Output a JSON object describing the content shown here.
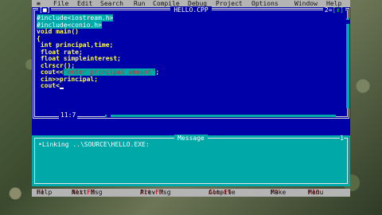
{
  "menu": {
    "system_glyph": "≡",
    "items": [
      {
        "name": "file",
        "label": "File"
      },
      {
        "name": "edit",
        "label": "Edit"
      },
      {
        "name": "search",
        "label": "Search"
      },
      {
        "name": "run",
        "label": "Run"
      },
      {
        "name": "compile",
        "label": "Compile"
      },
      {
        "name": "debug",
        "label": "Debug"
      },
      {
        "name": "project",
        "label": "Project"
      },
      {
        "name": "options",
        "label": "Options"
      },
      {
        "name": "window",
        "label": "Window"
      },
      {
        "name": "help",
        "label": "Help"
      }
    ]
  },
  "editor": {
    "close_glyph": "[■]",
    "title": "HELLO.CPP",
    "window_number": "2",
    "zoom_glyph": "[↕]",
    "cursor_position": "11:7",
    "code_lines": [
      {
        "text": "#include<iostream.h>",
        "selected": true
      },
      {
        "text": "#include<conio.h>",
        "selected": true
      },
      {
        "text": "void main()",
        "selected": false
      },
      {
        "text": "{",
        "selected": false
      },
      {
        "text": " int principal,time;",
        "selected": false
      },
      {
        "text": " float rate;",
        "selected": false
      },
      {
        "text": " float simpleinterest;",
        "selected": false
      },
      {
        "text": " clrscr();",
        "selected": false
      },
      {
        "text": " cout<<\"enter principal amount\";",
        "selected": false
      },
      {
        "text": " cin>>principal;",
        "selected": false
      },
      {
        "text": " cout<",
        "selected": false
      }
    ]
  },
  "message": {
    "title": "Message",
    "close_glyph": "1",
    "lines": [
      "•Linking ..\\SOURCE\\HELLO.EXE:"
    ]
  },
  "status": {
    "items": [
      {
        "key": "F1",
        "label": "Help"
      },
      {
        "key": "Alt-F8",
        "label": "Next Msg"
      },
      {
        "key": "Alt-F7",
        "label": "Prev Msg"
      },
      {
        "key": "Alt-F9",
        "label": "Compile"
      },
      {
        "key": "F9",
        "label": "Make"
      },
      {
        "key": "F10",
        "label": "Menu"
      }
    ]
  },
  "colors": {
    "editor_bg": "#0000a8",
    "code_text": "#ffff55",
    "selection": "#00a8a8",
    "menu_bg": "#b4b4b4",
    "hotkey": "#a00000"
  }
}
